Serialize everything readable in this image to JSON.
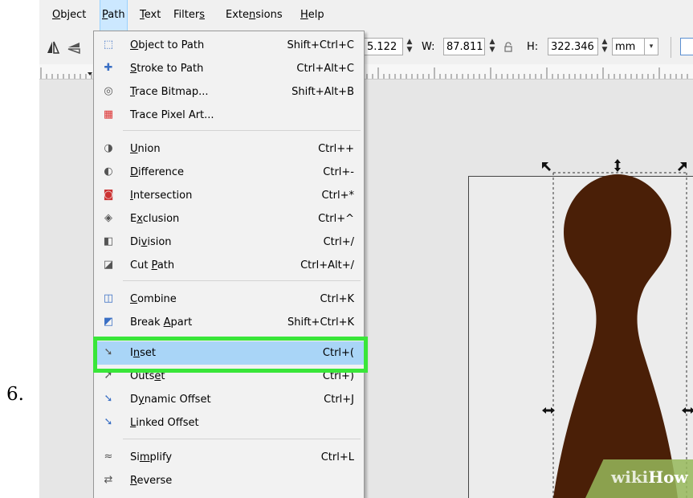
{
  "step_number": "6.",
  "menubar": {
    "items": [
      {
        "label": "Object",
        "underline": "O",
        "rest": "bject"
      },
      {
        "label": "Path",
        "underline": "P",
        "rest": "ath"
      },
      {
        "label": "Text",
        "underline": "T",
        "rest": "ext"
      },
      {
        "label": "Filters",
        "pre": "Filter",
        "underline": "s",
        "rest": ""
      },
      {
        "label": "Extensions",
        "pre": "Exte",
        "underline": "n",
        "rest": "sions"
      },
      {
        "label": "Help",
        "underline": "H",
        "rest": "elp"
      }
    ]
  },
  "toolbar": {
    "x_value": "5.122",
    "w_label": "W:",
    "w_value": "87.811",
    "h_label": "H:",
    "h_value": "322.346",
    "unit": "mm"
  },
  "path_menu": {
    "items": [
      {
        "icon": "object-to-path-icon",
        "glyph": "⬚",
        "pre": "",
        "u": "O",
        "post": "bject to Path",
        "shortcut": "Shift+Ctrl+C"
      },
      {
        "icon": "stroke-to-path-icon",
        "glyph": "✚",
        "pre": "",
        "u": "S",
        "post": "troke to Path",
        "shortcut": "Ctrl+Alt+C"
      },
      {
        "icon": "trace-bitmap-icon",
        "glyph": "◎",
        "pre": "",
        "u": "T",
        "post": "race Bitmap...",
        "shortcut": "Shift+Alt+B"
      },
      {
        "icon": "trace-pixel-art-icon",
        "glyph": "▦",
        "pre": "Trace Pixel Art...",
        "u": "",
        "post": "",
        "shortcut": ""
      },
      {
        "icon": "union-icon",
        "glyph": "◑",
        "pre": "",
        "u": "U",
        "post": "nion",
        "shortcut": "Ctrl++"
      },
      {
        "icon": "difference-icon",
        "glyph": "◐",
        "pre": "",
        "u": "D",
        "post": "ifference",
        "shortcut": "Ctrl+-"
      },
      {
        "icon": "intersection-icon",
        "glyph": "◙",
        "pre": "",
        "u": "I",
        "post": "ntersection",
        "shortcut": "Ctrl+*"
      },
      {
        "icon": "exclusion-icon",
        "glyph": "◈",
        "pre": "E",
        "u": "x",
        "post": "clusion",
        "shortcut": "Ctrl+^"
      },
      {
        "icon": "division-icon",
        "glyph": "◧",
        "pre": "Di",
        "u": "v",
        "post": "ision",
        "shortcut": "Ctrl+/"
      },
      {
        "icon": "cut-path-icon",
        "glyph": "◪",
        "pre": "Cut ",
        "u": "P",
        "post": "ath",
        "shortcut": "Ctrl+Alt+/"
      },
      {
        "icon": "combine-icon",
        "glyph": "◫",
        "pre": "",
        "u": "C",
        "post": "ombine",
        "shortcut": "Ctrl+K"
      },
      {
        "icon": "break-apart-icon",
        "glyph": "◩",
        "pre": "Break ",
        "u": "A",
        "post": "part",
        "shortcut": "Shift+Ctrl+K"
      },
      {
        "icon": "inset-icon",
        "glyph": "➘",
        "pre": "I",
        "u": "n",
        "post": "set",
        "shortcut": "Ctrl+("
      },
      {
        "icon": "outset-icon",
        "glyph": "➚",
        "pre": "Outs",
        "u": "e",
        "post": "t",
        "shortcut": "Ctrl+)"
      },
      {
        "icon": "dynamic-offset-icon",
        "glyph": "➘",
        "pre": "D",
        "u": "y",
        "post": "namic Offset",
        "shortcut": "Ctrl+J"
      },
      {
        "icon": "linked-offset-icon",
        "glyph": "➘",
        "pre": "",
        "u": "L",
        "post": "inked Offset",
        "shortcut": ""
      },
      {
        "icon": "simplify-icon",
        "glyph": "≈",
        "pre": "Si",
        "u": "m",
        "post": "plify",
        "shortcut": "Ctrl+L"
      },
      {
        "icon": "reverse-icon",
        "glyph": "⇄",
        "pre": "",
        "u": "R",
        "post": "everse",
        "shortcut": ""
      }
    ],
    "highlighted_item": "Inset"
  },
  "watermark": {
    "wiki": "wiki",
    "how": "How"
  },
  "colors": {
    "shape_fill": "#4a1f07",
    "highlight_box": "#39e639",
    "menu_hover": "#a9d5f7"
  }
}
